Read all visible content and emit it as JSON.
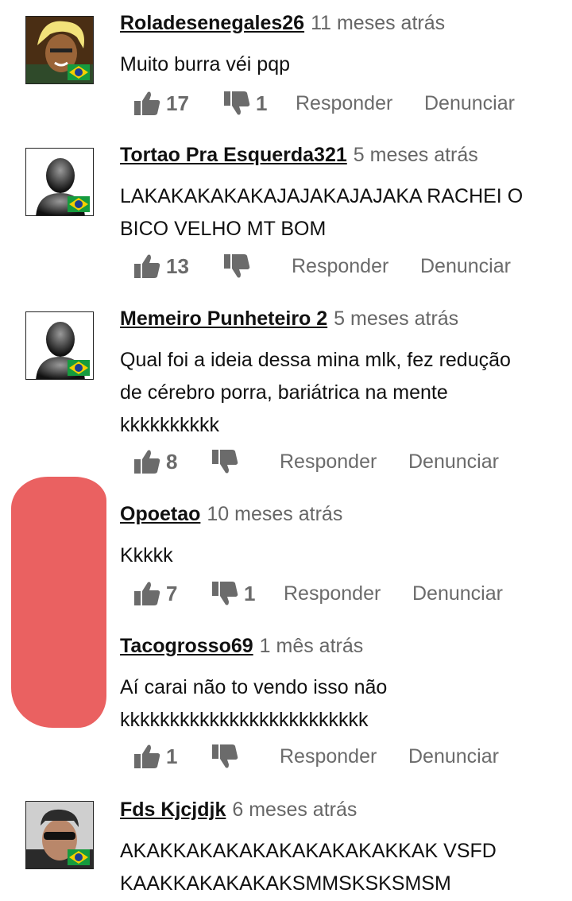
{
  "actions": {
    "reply_label": "Responder",
    "report_label": "Denunciar"
  },
  "comments": [
    {
      "author": "Roladesenegales26",
      "time": "11 meses atrás",
      "lines": [
        "Muito burra véi pqp"
      ],
      "likes": "17",
      "dislikes": "1",
      "avatar": "anime-character"
    },
    {
      "author": "Tortao Pra Esquerda321",
      "time": "5 meses atrás",
      "lines": [
        "LAKAKAKAKAKAJAJAKAJAJAKA RACHEI O",
        "BICO VELHO MT BOM"
      ],
      "likes": "13",
      "dislikes": "",
      "avatar": "default-silhouette"
    },
    {
      "author": "Memeiro Punheteiro 2",
      "time": "5 meses atrás",
      "lines": [
        "Qual foi a ideia dessa mina mlk, fez redução",
        "de cérebro porra, bariátrica na mente",
        "kkkkkkkkkk"
      ],
      "likes": "8",
      "dislikes": "",
      "avatar": "default-silhouette"
    },
    {
      "author": "Opoetao",
      "time": "10 meses atrás",
      "lines": [
        "Kkkkk"
      ],
      "likes": "7",
      "dislikes": "1",
      "avatar": "redacted"
    },
    {
      "author": "Tacogrosso69",
      "time": "1 mês atrás",
      "lines": [
        "Aí carai não to vendo isso não",
        "kkkkkkkkkkkkkkkkkkkkkkkkk"
      ],
      "likes": "1",
      "dislikes": "",
      "avatar": "redacted"
    },
    {
      "author": "Fds Kjcjdjk",
      "time": "6 meses atrás",
      "lines": [
        "AKAKKAKAKAKAKAKAKAKAKKAK VSFD",
        "KAAKKAKAKAKAKSMMSKSKSMSM"
      ],
      "likes": "",
      "dislikes": "",
      "avatar": "photo-sunglasses"
    }
  ],
  "colors": {
    "text": "#111111",
    "muted": "#666666",
    "action": "#6b6b6b",
    "redaction": "#ea6161"
  }
}
